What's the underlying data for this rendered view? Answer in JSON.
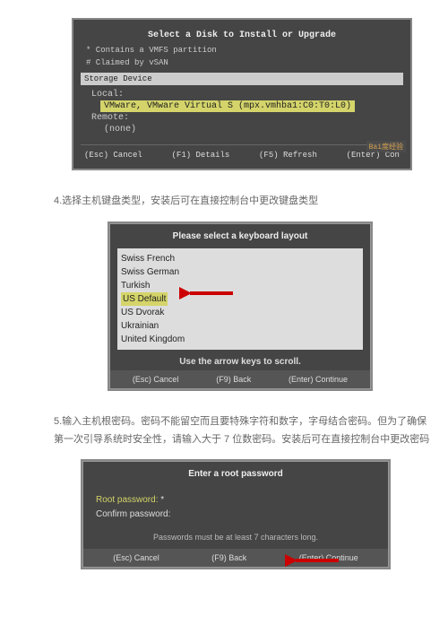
{
  "screen1": {
    "title": "Select a Disk to Install or Upgrade",
    "note1": "* Contains a VMFS partition",
    "note2": "# Claimed by vSAN",
    "panel_label": "Storage Device",
    "local_label": "Local:",
    "local_item": "VMware, VMware Virtual S (mpx.vmhba1:C0:T0:L0)",
    "remote_label": "Remote:",
    "remote_item": "(none)",
    "footer_esc": "(Esc) Cancel",
    "footer_f1": "(F1) Details",
    "footer_f5": "(F5) Refresh",
    "footer_enter": "(Enter) Con",
    "watermark": "Bai度经验"
  },
  "step4": {
    "text": "4.选择主机键盘类型，安装后可在直接控制台中更改键盘类型"
  },
  "screen2": {
    "title": "Please select a keyboard layout",
    "items": [
      "Swiss French",
      "Swiss German",
      "Turkish",
      "US Default",
      "US Dvorak",
      "Ukrainian",
      "United Kingdom"
    ],
    "hint": "Use the arrow keys to scroll.",
    "footer_esc": "(Esc) Cancel",
    "footer_f9": "(F9) Back",
    "footer_enter": "(Enter) Continue"
  },
  "step5": {
    "text": "5.输入主机根密码。密码不能留空而且要特殊字符和数字，字母结合密码。但为了确保第一次引导系统时安全性，请输入大于 7 位数密码。安装后可在直接控制台中更改密码"
  },
  "screen3": {
    "title": "Enter a root password",
    "root_label": "Root password:",
    "root_value": "*",
    "confirm_label": "Confirm password:",
    "hint": "Passwords must be at least 7 characters long.",
    "footer_esc": "(Esc) Cancel",
    "footer_f9": "(F9) Back",
    "footer_enter": "(Enter) Continue"
  }
}
